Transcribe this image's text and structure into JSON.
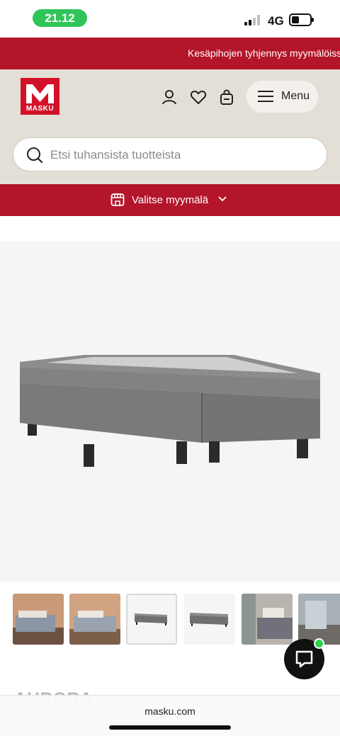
{
  "status_bar": {
    "time": "21.12",
    "network": "4G"
  },
  "promo": {
    "text": "Kesäpihojen tyhjennys myymälöissä!"
  },
  "header": {
    "logo_text": "MASKU",
    "menu_label": "Menu",
    "search_placeholder": "Etsi tuhansista tuotteista"
  },
  "store": {
    "label": "Valitse myymälä"
  },
  "product": {
    "title_peek": "AURORA"
  },
  "browser": {
    "url": "masku.com"
  },
  "colors": {
    "brand_red": "#b3152a",
    "header_bg": "#e4dfd6",
    "chat_online": "#2bd24b"
  },
  "icons": [
    "account-icon",
    "heart-icon",
    "bag-icon",
    "hamburger-icon",
    "search-icon",
    "store-icon",
    "chevron-down-icon",
    "chat-icon"
  ]
}
